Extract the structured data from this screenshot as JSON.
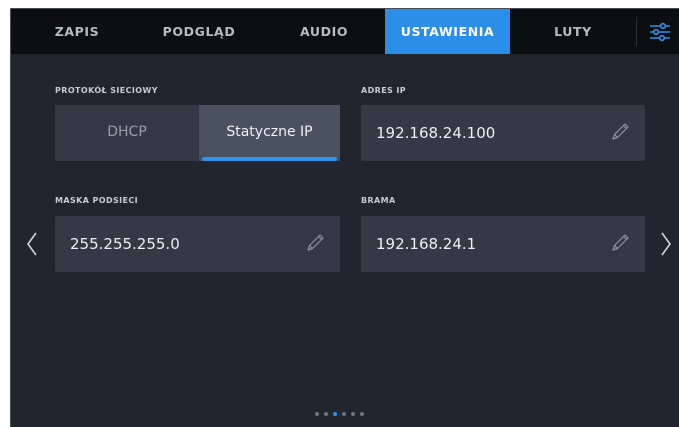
{
  "tabs": [
    {
      "label": "ZAPIS",
      "active": false
    },
    {
      "label": "PODGLĄD",
      "active": false
    },
    {
      "label": "AUDIO",
      "active": false
    },
    {
      "label": "USTAWIENIA",
      "active": true
    },
    {
      "label": "LUTY",
      "active": false
    }
  ],
  "menu_icon": "sliders-icon",
  "network_protocol": {
    "label": "PROTOKÓŁ SIECIOWY",
    "options": [
      "DHCP",
      "Statyczne IP"
    ],
    "selected": "Statyczne IP"
  },
  "ip_address": {
    "label": "ADRES IP",
    "value": "192.168.24.100"
  },
  "subnet_mask": {
    "label": "MASKA PODSIECI",
    "value": "255.255.255.0"
  },
  "gateway": {
    "label": "BRAMA",
    "value": "192.168.24.1"
  },
  "navigation": {
    "prev_icon": "chevron-left-icon",
    "next_icon": "chevron-right-icon"
  },
  "pagination": {
    "total": 6,
    "current": 3
  },
  "colors": {
    "accent": "#2b8ee8",
    "background": "#20252e",
    "tabbar": "#0c0e11",
    "field": "#333945"
  }
}
